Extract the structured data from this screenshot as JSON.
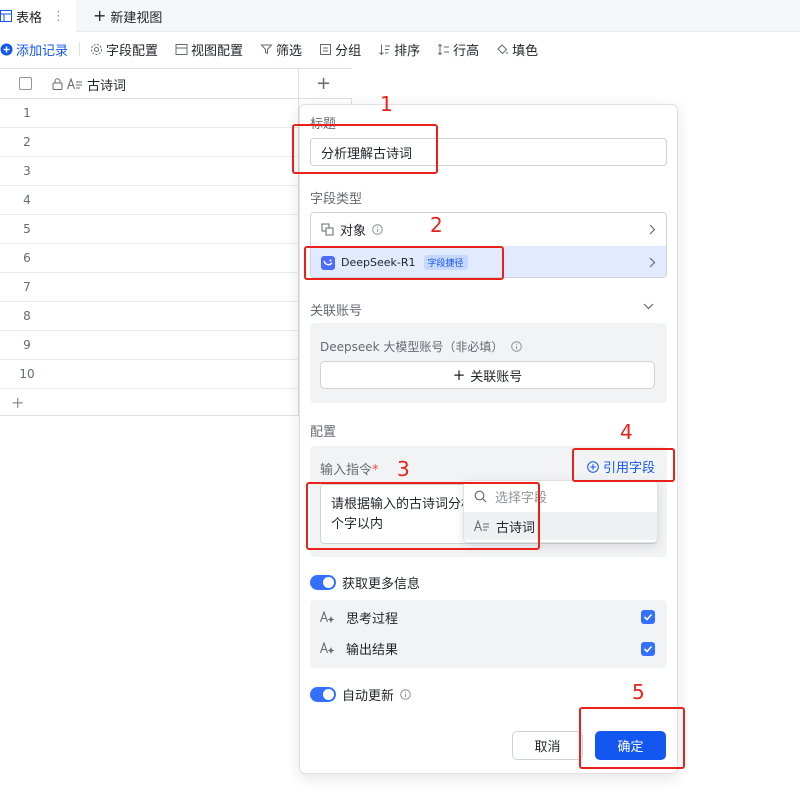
{
  "tabs": {
    "active_label": "表格",
    "more_icon": "⋮",
    "new_view_label": "新建视图"
  },
  "toolbar": {
    "add_record": "添加记录",
    "field_config": "字段配置",
    "view_config": "视图配置",
    "filter": "筛选",
    "group": "分组",
    "sort": "排序",
    "row_height": "行高",
    "fill_color": "填色"
  },
  "grid": {
    "column_name": "古诗词",
    "rows": [
      "1",
      "2",
      "3",
      "4",
      "5",
      "6",
      "7",
      "8",
      "9",
      "10"
    ]
  },
  "panel": {
    "title_label": "标题",
    "title_value": "分析理解古诗词",
    "field_type_label": "字段类型",
    "type_object": "对象",
    "type_model": "DeepSeek-R1",
    "type_model_tag": "字段捷径",
    "account_label": "关联账号",
    "account_desc": "Deepseek 大模型账号（非必填）",
    "account_button": "关联账号",
    "config_label": "配置",
    "instruction_label": "输入指令",
    "required_mark": "*",
    "reference_button": "引用字段",
    "instruction_line1": "请根据输入的古诗词分析",
    "instruction_line2": "个字以内",
    "more_info_label": "获取更多信息",
    "opt_thinking": "思考过程",
    "opt_output": "输出结果",
    "auto_update_label": "自动更新",
    "cancel": "取消",
    "confirm": "确定"
  },
  "dropdown": {
    "search_placeholder": "选择字段",
    "option": "古诗词"
  },
  "annotations": {
    "n1": "1",
    "n2": "2",
    "n3": "3",
    "n4": "4",
    "n5": "5"
  },
  "colors": {
    "accent": "#1456f0",
    "annotation": "#e8221b",
    "selected_bg": "#e1eaff"
  }
}
